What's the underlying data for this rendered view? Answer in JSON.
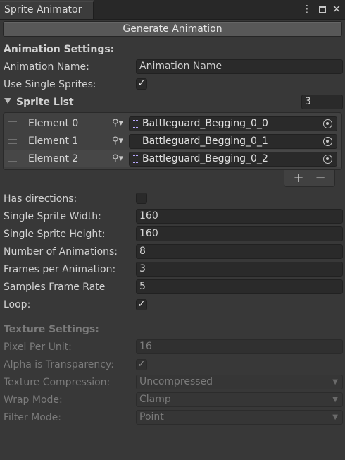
{
  "window": {
    "tab_title": "Sprite Animator",
    "menu_icon": "kebab-menu-icon",
    "maximize_icon": "maximize-icon",
    "close_icon": "close-icon"
  },
  "generate_button": "Generate Animation",
  "animation_settings": {
    "header": "Animation Settings:",
    "name_label": "Animation Name:",
    "name_value": "Animation Name",
    "single_sprites_label": "Use Single Sprites:",
    "single_sprites_checked": "✓"
  },
  "sprite_list": {
    "label": "Sprite List",
    "count": "3",
    "elements": [
      {
        "label": "Element 0",
        "value": "Battleguard_Begging_0_0"
      },
      {
        "label": "Element 1",
        "value": "Battleguard_Begging_0_1"
      },
      {
        "label": "Element 2",
        "value": "Battleguard_Begging_0_2"
      }
    ],
    "add": "+",
    "remove": "−"
  },
  "settings": {
    "has_directions_label": "Has directions:",
    "width_label": "Single Sprite Width:",
    "width_value": "160",
    "height_label": "Single Sprite Height:",
    "height_value": "160",
    "num_anims_label": "Number of Animations:",
    "num_anims_value": "8",
    "frames_label": "Frames per Animation:",
    "frames_value": "3",
    "rate_label": "Samples Frame Rate",
    "rate_value": "5",
    "loop_label": "Loop:",
    "loop_checked": "✓"
  },
  "texture_settings": {
    "header": "Texture Settings:",
    "ppu_label": "Pixel Per Unit:",
    "ppu_value": "16",
    "alpha_label": "Alpha is Transparency:",
    "alpha_checked": "✓",
    "compression_label": "Texture Compression:",
    "compression_value": "Uncompressed",
    "wrap_label": "Wrap Mode:",
    "wrap_value": "Clamp",
    "filter_label": "Filter Mode:",
    "filter_value": "Point"
  }
}
